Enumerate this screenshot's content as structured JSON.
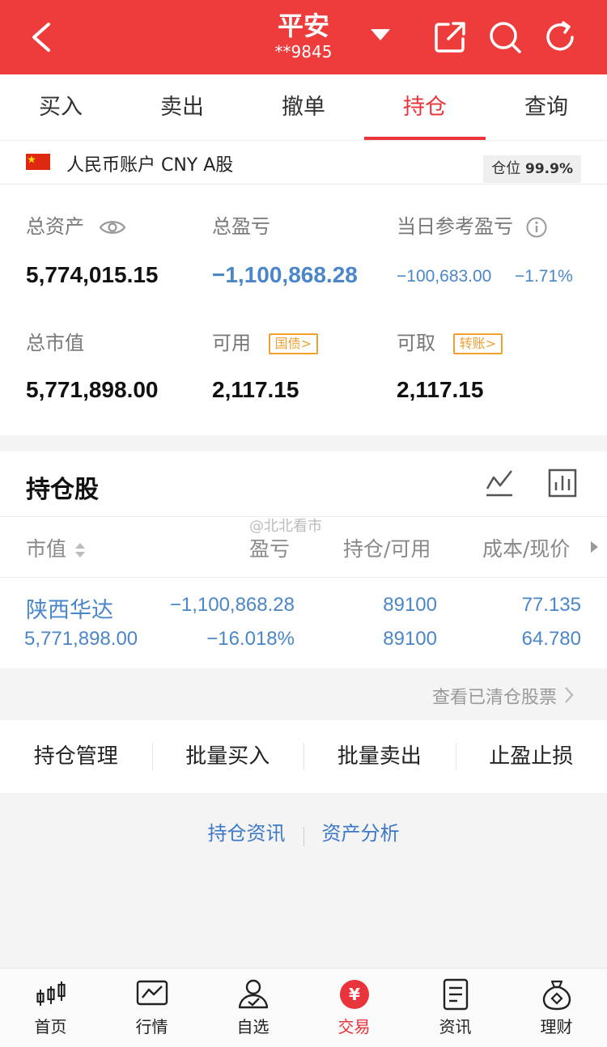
{
  "header": {
    "title": "平安",
    "account_masked": "**9845",
    "colors": {
      "bg": "#ee3b3b"
    }
  },
  "tabs": [
    {
      "label": "买入"
    },
    {
      "label": "卖出"
    },
    {
      "label": "撤单"
    },
    {
      "label": "持仓",
      "active": true
    },
    {
      "label": "查询"
    }
  ],
  "account": {
    "name": "人民币账户 CNY A股",
    "position_label": "仓位",
    "position_value": "99.9%",
    "total_assets_label": "总资产",
    "total_assets": "5,774,015.15",
    "total_pl_label": "总盈亏",
    "total_pl": "−1,100,868.28",
    "today_pl_label": "当日参考盈亏",
    "today_pl": "−100,683.00",
    "today_pl_pct": "−1.71%",
    "market_value_label": "总市值",
    "market_value": "5,771,898.00",
    "available_label": "可用",
    "available_tag": "国债>",
    "available": "2,117.15",
    "withdrawable_label": "可取",
    "withdrawable_tag": "转账>",
    "withdrawable": "2,117.15"
  },
  "positions": {
    "title": "持仓股",
    "watermark": "@北北看市",
    "columns": [
      "市值",
      "盈亏",
      "持仓/可用",
      "成本/现价"
    ],
    "rows": [
      {
        "name": "陕西华达",
        "market_value": "5,771,898.00",
        "pl": "−1,100,868.28",
        "pl_pct": "−16.018%",
        "holding": "89100",
        "available": "89100",
        "cost": "77.135",
        "price": "64.780"
      }
    ],
    "view_cleared": "查看已清仓股票"
  },
  "actions": [
    "持仓管理",
    "批量买入",
    "批量卖出",
    "止盈止损"
  ],
  "links": [
    "持仓资讯",
    "资产分析"
  ],
  "nav": [
    {
      "label": "首页",
      "icon": "candlestick-icon"
    },
    {
      "label": "行情",
      "icon": "chart-icon"
    },
    {
      "label": "自选",
      "icon": "user-check-icon"
    },
    {
      "label": "交易",
      "icon": "yuan-icon",
      "active": true
    },
    {
      "label": "资讯",
      "icon": "document-icon"
    },
    {
      "label": "理财",
      "icon": "money-bag-icon"
    }
  ]
}
